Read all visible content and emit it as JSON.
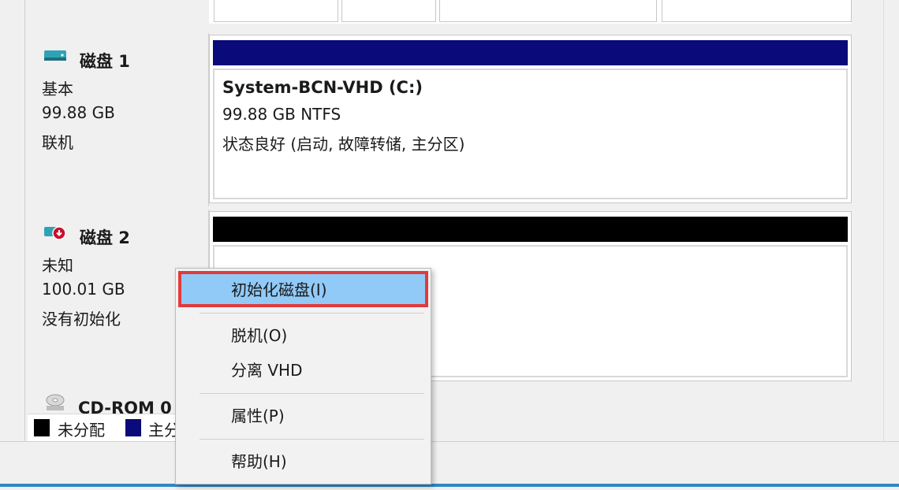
{
  "disks": [
    {
      "title": "磁盘 1",
      "type": "基本",
      "size": "99.88 GB",
      "status": "联机",
      "bar_color": "#0a0a7a",
      "volume": {
        "title": "System-BCN-VHD  (C:)",
        "fs": "99.88 GB NTFS",
        "health": "状态良好 (启动, 故障转储, 主分区)"
      }
    },
    {
      "title": "磁盘 2",
      "type": "未知",
      "size": "100.01 GB",
      "status": "没有初始化",
      "bar_color": "#000000"
    }
  ],
  "cdrom": {
    "title": "CD-ROM 0"
  },
  "legend": {
    "unallocated": {
      "label": "未分配",
      "color": "#000000"
    },
    "primary": {
      "label": "主分",
      "color": "#0a0a7a"
    }
  },
  "context_menu": {
    "items": [
      {
        "label": "初始化磁盘(I)",
        "highlighted": true
      },
      {
        "label": "脱机(O)"
      },
      {
        "label": "分离 VHD"
      },
      {
        "label": "属性(P)"
      },
      {
        "label": "帮助(H)"
      }
    ],
    "highlight_color": "#91c9f7",
    "annotation_color": "#e23a3a"
  },
  "icons": {
    "disk_online": "disk-drive-icon",
    "disk_uninitialized": "disk-error-icon",
    "cdrom": "cd-rom-icon"
  }
}
